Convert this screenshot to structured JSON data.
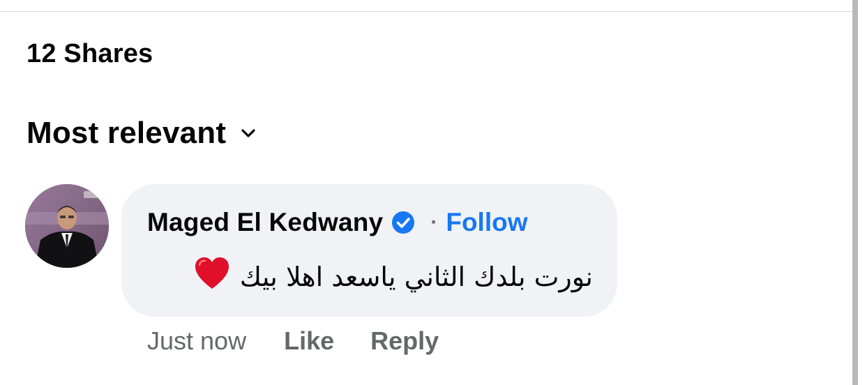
{
  "shares": {
    "label": "12 Shares"
  },
  "sort": {
    "label": "Most relevant",
    "icon": "chevron-down-icon"
  },
  "comment": {
    "author": "Maged El Kedwany",
    "verified_icon": "verified-badge-icon",
    "separator": "·",
    "follow_label": "Follow",
    "text": "نورت بلدك الثاني ياسعد اهلا بيك",
    "emoji_icon": "red-heart-icon",
    "timestamp": "Just now",
    "like_label": "Like",
    "reply_label": "Reply"
  },
  "colors": {
    "follow": "#1877f2",
    "bubble": "#f0f2f5",
    "meta": "#65676b",
    "verified": "#1877f2",
    "heart": "#e0102b"
  }
}
